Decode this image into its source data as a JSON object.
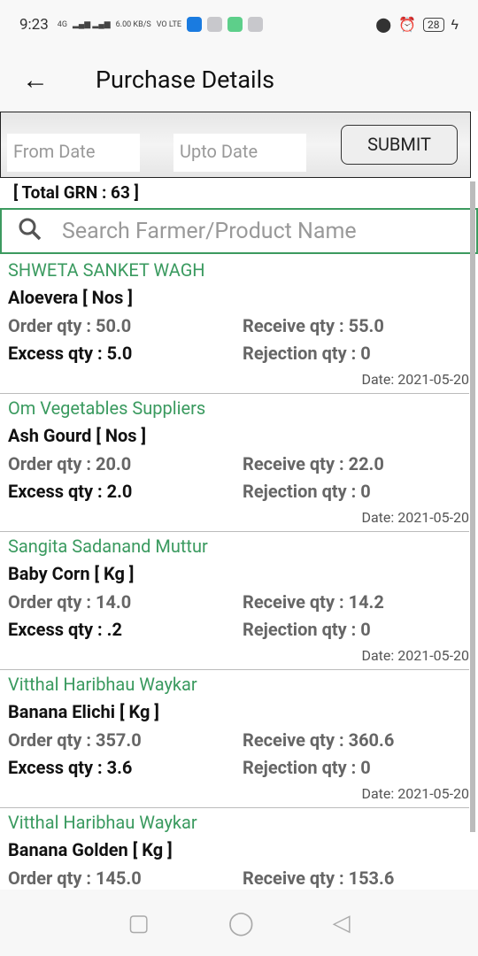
{
  "status": {
    "time": "9:23",
    "net": "4G",
    "speed": "6.00 KB/S",
    "volte": "VO LTE",
    "battery": "28"
  },
  "appbar": {
    "title": "Purchase Details"
  },
  "filter": {
    "from_placeholder": "From Date",
    "upto_placeholder": "Upto Date",
    "submit": "SUBMIT"
  },
  "total": "[ Total GRN : 63 ]",
  "search": {
    "placeholder": "Search Farmer/Product Name"
  },
  "colors": {
    "accent": "#3a9a5f"
  },
  "items": [
    {
      "farmer": "SHWETA SANKET WAGH",
      "product": "Aloevera [ Nos ]",
      "order": "Order qty : 50.0",
      "receive": "Receive qty : 55.0",
      "excess": "Excess qty : 5.0",
      "rejection": "Rejection qty : 0",
      "date": "Date: 2021-05-20"
    },
    {
      "farmer": "Om Vegetables Suppliers",
      "product": "Ash Gourd [ Nos ]",
      "order": "Order qty : 20.0",
      "receive": "Receive qty : 22.0",
      "excess": "Excess qty : 2.0",
      "rejection": "Rejection qty : 0",
      "date": "Date: 2021-05-20"
    },
    {
      "farmer": "Sangita Sadanand Muttur",
      "product": "Baby Corn [ Kg ]",
      "order": "Order qty : 14.0",
      "receive": "Receive qty : 14.2",
      "excess": "Excess qty : .2",
      "rejection": "Rejection qty : 0",
      "date": "Date: 2021-05-20"
    },
    {
      "farmer": "Vitthal Haribhau Waykar",
      "product": "Banana Elichi [ Kg ]",
      "order": "Order qty : 357.0",
      "receive": "Receive qty : 360.6",
      "excess": "Excess qty : 3.6",
      "rejection": "Rejection qty : 0",
      "date": "Date: 2021-05-20"
    },
    {
      "farmer": "Vitthal Haribhau Waykar",
      "product": "Banana Golden [ Kg ]",
      "order": "Order qty : 145.0",
      "receive": "Receive qty : 153.6"
    }
  ]
}
